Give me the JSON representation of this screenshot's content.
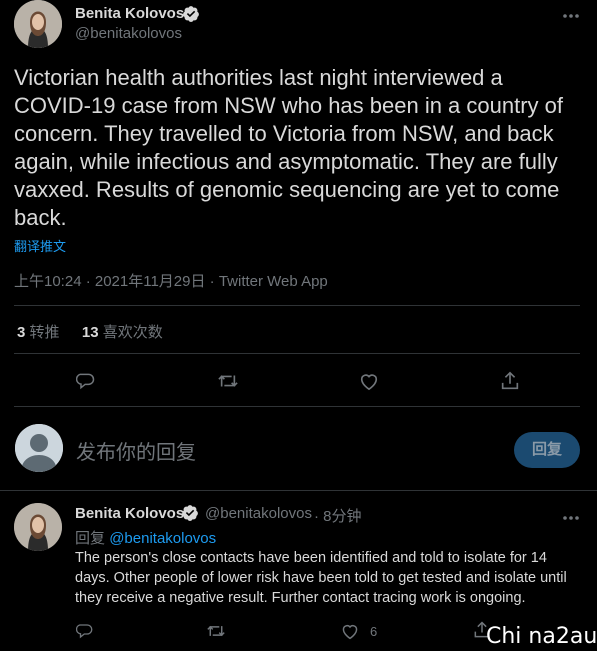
{
  "tweet": {
    "author_name": "Benita Kolovos",
    "author_handle": "@benitakolovos",
    "text": "Victorian health authorities last night interviewed a COVID-19 case from NSW who has been in a country of concern. They travelled to Victoria from NSW, and back again, while infectious and asymptomatic. They are fully vaxxed. Results of genomic sequencing are yet to come back.",
    "translate_label": "翻译推文",
    "timestamp": "上午10:24 · 2021年11月29日 · Twitter Web App",
    "retweets_count": "3",
    "retweets_label": "转推",
    "likes_count": "13",
    "likes_label": "喜欢次数"
  },
  "compose": {
    "placeholder": "发布你的回复",
    "reply_button_label": "回复"
  },
  "reply": {
    "author_name": "Benita Kolovos",
    "author_handle": "@benitakolovos",
    "time": "· 8分钟",
    "replying_to_label": "回复",
    "replying_to_handle": "@benitakolovos",
    "text": "The person's close contacts have been identified and told to isolate for 14 days. Other people of lower risk have been told to get tested and isolate until they receive a negative result. Further contact tracing work is ongoing.",
    "like_count": "6"
  },
  "watermark": "Chi na2au",
  "icons": {
    "verified": "verified-badge-icon",
    "more": "more-icon",
    "reply": "reply-icon",
    "retweet": "retweet-icon",
    "like": "heart-icon",
    "share": "share-icon"
  },
  "colors": {
    "background": "#000000",
    "text": "#d9d9d9",
    "muted": "#71767b",
    "accent": "#1d9bf0",
    "divider": "#2f3336"
  }
}
